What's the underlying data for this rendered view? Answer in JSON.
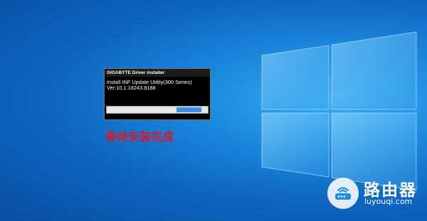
{
  "installer": {
    "title": "GIGABYTE Driver installer",
    "item_name": "Install INF Update Utility(300 Series)",
    "version": "Ver:10.1.18243.8188",
    "progress": {
      "value": 0.67,
      "filled_segment": {
        "start": 0.69,
        "end": 0.94
      }
    }
  },
  "status_message": "等待安装完成",
  "watermark": {
    "name": "路由器",
    "domain": "luyouqi.com",
    "icon": "router-icon"
  },
  "colors": {
    "desktop_bg": "#1a86db",
    "status_text": "#d41b2e",
    "progress_fill": "#3d8fe6",
    "window_bg": "#000000"
  }
}
